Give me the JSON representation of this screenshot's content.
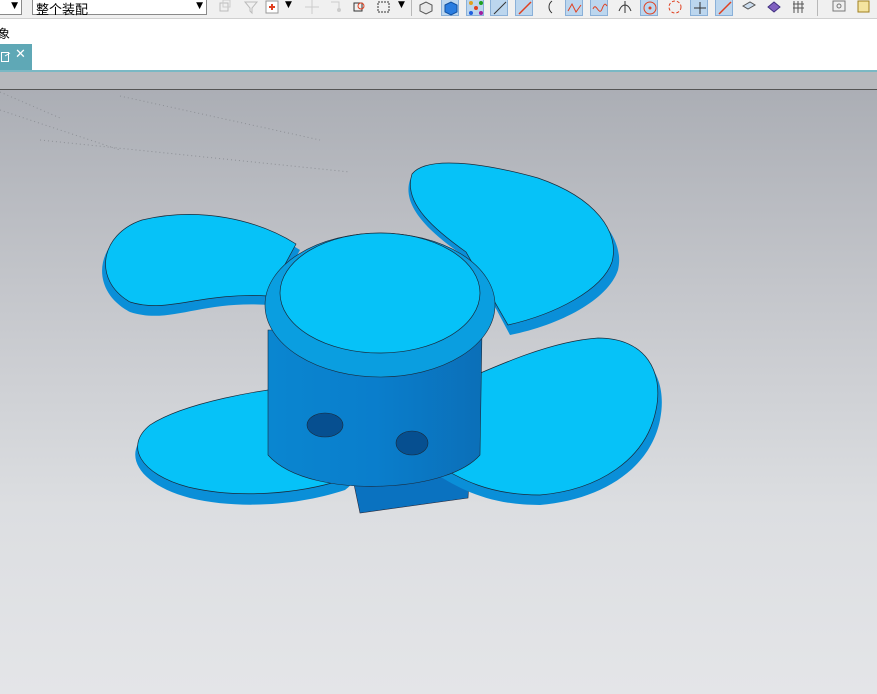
{
  "toolbar": {
    "left_dropdown_value": "",
    "filter_dropdown_value": "整个装配",
    "icons": [
      "select-component-icon",
      "filter-icon",
      "snap-point-icon",
      "crosshair-icon",
      "point-on-icon",
      "box-select-icon",
      "rect-select-icon",
      "solid-view-icon",
      "blue-cube-icon",
      "move-handles-icon",
      "line-tool-icon",
      "arc-endpoint-icon",
      "curve-tool-icon",
      "spline-icon",
      "wave-curve-icon",
      "intersect-icon",
      "circle-center-icon",
      "circle-point-icon",
      "plus-point-icon",
      "line-segment-icon",
      "surface-tool-icon",
      "face-shade-icon",
      "grid-icon",
      "orient-view-icon",
      "layer-icon"
    ]
  },
  "status": {
    "text": "象"
  },
  "tab": {
    "close_label": "✕"
  },
  "colors": {
    "model": "#06c2f8",
    "model_dark": "#0a8fd8",
    "tab": "#5fa8b6"
  }
}
